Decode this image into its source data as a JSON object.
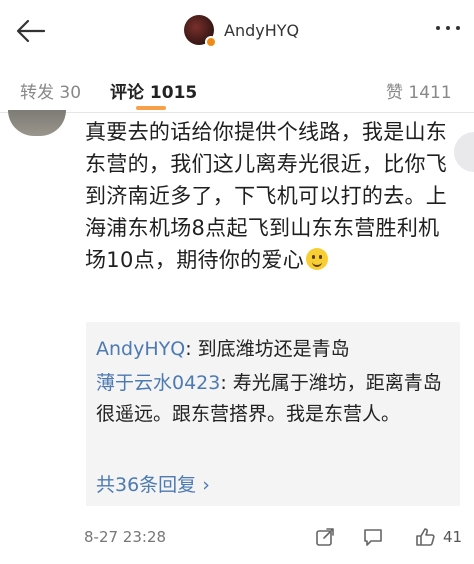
{
  "header": {
    "username": "AndyHYQ"
  },
  "tabs": {
    "repost": "转发 30",
    "comments": "评论 1015",
    "likes": "赞 1411"
  },
  "comment": {
    "text": "真要去的话给你提供个线路，我是山东东营的，我们这儿离寿光很近，比你飞到济南近多了，下飞机可以打的去。上海浦东机场8点起飞到山东东营胜利机场10点，期待你的爱心",
    "emoji": "smile-emoji",
    "time": "8-27 23:28",
    "like_count": "41"
  },
  "replies": [
    {
      "name": "AndyHYQ",
      "text": ": 到底潍坊还是青岛"
    },
    {
      "name": "薄于云水0423",
      "text": ": 寿光属于潍坊，距离青岛很遥远。跟东营搭界。我是东营人。"
    }
  ],
  "more_replies": "共36条回复 ›",
  "colors": {
    "accent": "#f6a04a",
    "link": "#4d7ab2",
    "reply_bg": "#f4f4f4"
  }
}
